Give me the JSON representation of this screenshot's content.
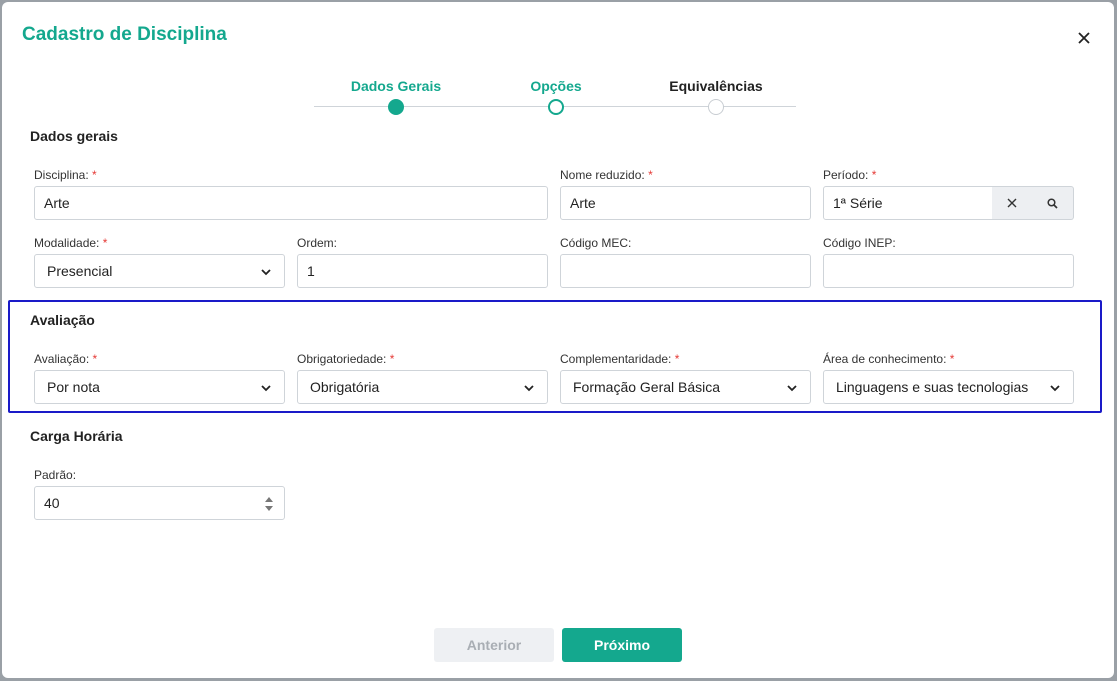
{
  "modal": {
    "title": "Cadastro de Disciplina"
  },
  "icons": {
    "close": "close-icon",
    "clear": "x-icon",
    "search": "magnifier-icon",
    "dropdown": "chevron-down-icon",
    "spinner": "up-down-arrows-icon"
  },
  "colors": {
    "accent": "#14a88e",
    "required": "#e53935",
    "highlight_border": "#1a1ac8"
  },
  "stepper": [
    {
      "label": "Dados Gerais",
      "state": "done"
    },
    {
      "label": "Opções",
      "state": "current"
    },
    {
      "label": "Equivalências",
      "state": "todo"
    }
  ],
  "sections": {
    "dados_gerais": "Dados gerais",
    "avaliacao": "Avaliação",
    "carga_horaria": "Carga Horária"
  },
  "fields": {
    "disciplina": {
      "label": "Disciplina:",
      "value": "Arte",
      "required": "*"
    },
    "nome_reduzido": {
      "label": "Nome reduzido:",
      "value": "Arte",
      "required": "*"
    },
    "periodo": {
      "label": "Período:",
      "value": "1ª Série",
      "required": "*"
    },
    "modalidade": {
      "label": "Modalidade:",
      "value": "Presencial",
      "required": "*"
    },
    "ordem": {
      "label": "Ordem:",
      "value": "1"
    },
    "codigo_mec": {
      "label": "Código MEC:",
      "value": ""
    },
    "codigo_inep": {
      "label": "Código INEP:",
      "value": ""
    },
    "avaliacao": {
      "label": "Avaliação:",
      "value": "Por nota",
      "required": "*"
    },
    "obrigatoriedade": {
      "label": "Obrigatoriedade:",
      "value": "Obrigatória",
      "required": "*"
    },
    "complementaridade": {
      "label": "Complementaridade:",
      "value": "Formação Geral Básica",
      "required": "*"
    },
    "area_conhecimento": {
      "label": "Área de conhecimento:",
      "value": "Linguagens e suas tecnologias",
      "required": "*"
    },
    "padrao": {
      "label": "Padrão:",
      "value": "40"
    }
  },
  "footer": {
    "prev_label": "Anterior",
    "next_label": "Próximo"
  }
}
